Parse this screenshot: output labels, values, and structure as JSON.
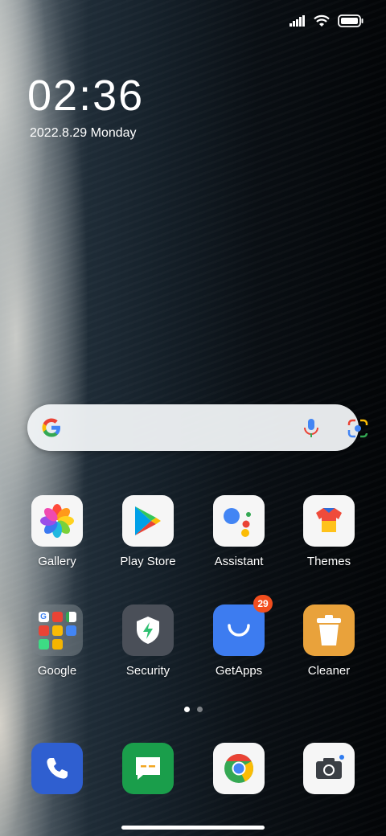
{
  "status_bar": {
    "icons": [
      "signal-icon",
      "wifi-icon",
      "battery-icon"
    ]
  },
  "clock": {
    "time": "02:36",
    "date": "2022.8.29 Monday"
  },
  "search_bar": {
    "icons": [
      "google-g-icon",
      "microphone-icon",
      "google-lens-icon"
    ]
  },
  "apps": [
    {
      "label": "Gallery",
      "icon": "gallery-icon"
    },
    {
      "label": "Play Store",
      "icon": "play-store-icon"
    },
    {
      "label": "Assistant",
      "icon": "assistant-icon"
    },
    {
      "label": "Themes",
      "icon": "themes-icon"
    },
    {
      "label": "Google",
      "icon": "google-folder-icon"
    },
    {
      "label": "Security",
      "icon": "security-icon"
    },
    {
      "label": "GetApps",
      "icon": "getapps-icon",
      "badge": "29"
    },
    {
      "label": "Cleaner",
      "icon": "cleaner-icon"
    }
  ],
  "page_indicator": {
    "pages": 2,
    "current": 1
  },
  "dock": [
    {
      "icon": "phone-icon"
    },
    {
      "icon": "messages-icon"
    },
    {
      "icon": "chrome-icon"
    },
    {
      "icon": "camera-icon"
    }
  ],
  "colors": {
    "phone": "#2f5fd0",
    "messages": "#1a9e4b",
    "getapps": "#3d7cf0",
    "cleaner": "#e9a23b",
    "security": "#4a4f58",
    "badge": "#f24e1e"
  }
}
